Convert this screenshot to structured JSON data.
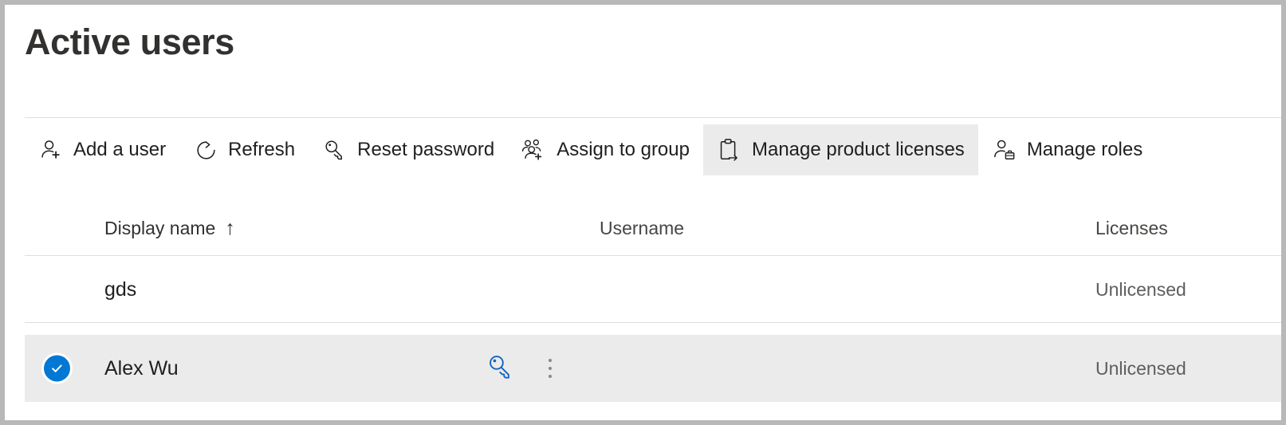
{
  "page": {
    "title": "Active users"
  },
  "colors": {
    "accent": "#0078d4",
    "selected_row_bg": "#ebebeb",
    "selected_command_bg": "#ebebeb",
    "title_text": "#323130",
    "secondary_text": "#605e5c",
    "divider": "#e1dfdd"
  },
  "command_bar": {
    "items": [
      {
        "id": "add-a-user",
        "label": "Add a user",
        "icon": "person-add-icon",
        "selected": false
      },
      {
        "id": "refresh",
        "label": "Refresh",
        "icon": "refresh-icon",
        "selected": false
      },
      {
        "id": "reset-password",
        "label": "Reset password",
        "icon": "key-icon",
        "selected": false
      },
      {
        "id": "assign-to-group",
        "label": "Assign to group",
        "icon": "people-add-icon",
        "selected": false
      },
      {
        "id": "manage-product-licenses",
        "label": "Manage product licenses",
        "icon": "clipboard-arrow-icon",
        "selected": true
      },
      {
        "id": "manage-roles",
        "label": "Manage roles",
        "icon": "person-briefcase-icon",
        "selected": false
      }
    ]
  },
  "table": {
    "columns": [
      {
        "id": "display-name",
        "label": "Display name",
        "sort": "ascending",
        "sort_glyph": "↑"
      },
      {
        "id": "username",
        "label": "Username",
        "sort": "none"
      },
      {
        "id": "licenses",
        "label": "Licenses",
        "sort": "none"
      }
    ],
    "rows": [
      {
        "display_name": "gds",
        "username": "",
        "licenses": "Unlicensed",
        "selected": false
      },
      {
        "display_name": "Alex Wu",
        "username": "",
        "licenses": "Unlicensed",
        "selected": true,
        "row_actions": [
          {
            "id": "reset-password-row-action",
            "icon": "key-icon"
          },
          {
            "id": "more-actions",
            "icon": "more-vertical-icon"
          }
        ]
      }
    ]
  }
}
